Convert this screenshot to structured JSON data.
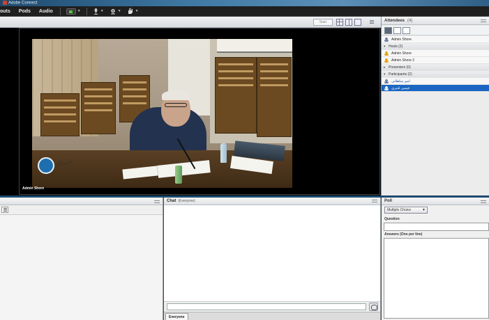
{
  "window": {
    "title": "Adobe Connect"
  },
  "menubar": {
    "items": [
      "outs",
      "Pods",
      "Audio"
    ]
  },
  "video_pod": {
    "stop_label": "Start",
    "presenter_name": "Admin Shore",
    "logo_text": "دانشگاه"
  },
  "attendees": {
    "title": "Attendees",
    "count": "(4)",
    "me_label": "Admin Shore",
    "groups": [
      {
        "label": "Hosts (2)",
        "members": [
          "Admin Shore",
          "Admin Shore 2"
        ]
      },
      {
        "label": "Presenters (0)",
        "members": []
      },
      {
        "label": "Participants (2)",
        "members": [
          "امیر سلطانی",
          "عیسی قنبری"
        ]
      }
    ]
  },
  "chat": {
    "title": "Chat",
    "subtitle": "(Everyone)",
    "tab_label": "Everyone"
  },
  "poll": {
    "title": "Poll",
    "type_selected": "Multiple Choice",
    "question_label": "Question",
    "answers_label": "Answers (One per line)"
  },
  "colors": {
    "accent": "#1a66c2",
    "menubar_bg": "#1f1f1f",
    "mic_active": "#57c63b"
  }
}
